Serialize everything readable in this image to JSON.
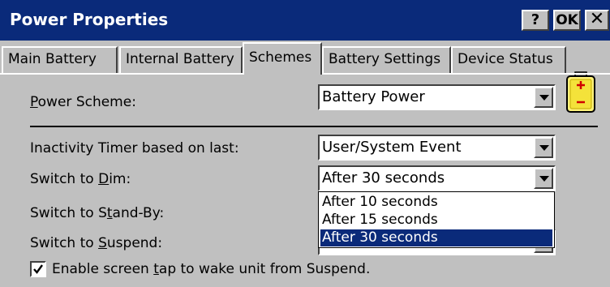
{
  "window": {
    "title": "Power Properties",
    "help_label": "?",
    "ok_label": "OK",
    "close_label": "✕"
  },
  "tabs": [
    {
      "label": "Main Battery",
      "active": false
    },
    {
      "label": "Internal Battery",
      "active": false
    },
    {
      "label": "Schemes",
      "active": true
    },
    {
      "label": "Battery Settings",
      "active": false
    },
    {
      "label": "Device Status",
      "active": false
    }
  ],
  "form": {
    "power_scheme": {
      "pre": "",
      "key": "P",
      "post": "ower Scheme:",
      "value": "Battery Power"
    },
    "inactivity": {
      "label": "Inactivity Timer based on last:",
      "value": "User/System Event"
    },
    "dim": {
      "pre": "Switch to ",
      "key": "D",
      "post": "im:",
      "value": "After 30 seconds"
    },
    "standby": {
      "pre": "Switch to S",
      "key": "t",
      "post": "and-By:"
    },
    "suspend": {
      "pre": "Switch to ",
      "key": "S",
      "post": "uspend:"
    },
    "enable_tap": {
      "pre": "Enable screen ",
      "key": "t",
      "post": "ap to wake unit from Suspend.",
      "checked": true
    }
  },
  "dropdown": {
    "options": [
      "After 10 seconds",
      "After 15 seconds",
      "After 30 seconds"
    ],
    "selected_index": 2
  },
  "colors": {
    "title_bar": "#0a2a7a",
    "selection": "#0a2a7a",
    "dialog_bg": "#c0c0c0"
  },
  "icons": [
    "battery-icon",
    "chevron-down-icon",
    "check-icon"
  ]
}
